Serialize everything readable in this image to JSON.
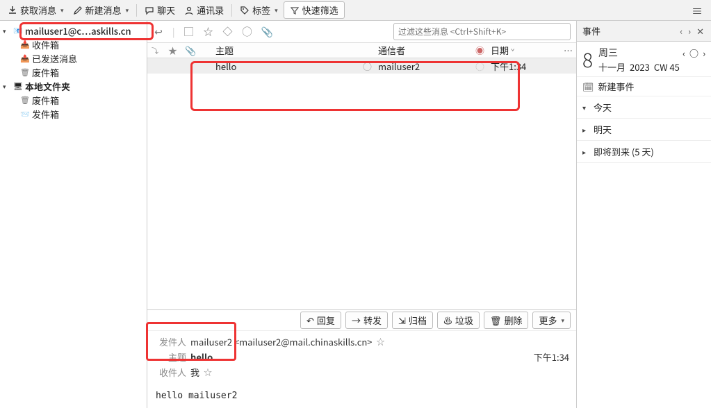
{
  "toolbar": {
    "get_msgs": "获取消息",
    "new_msg": "新建消息",
    "chat": "聊天",
    "contacts": "通讯录",
    "tags": "标签",
    "quick_filter": "快速筛选"
  },
  "sidebar": {
    "account": "mailuser1@c…askills.cn",
    "inbox": "收件箱",
    "sent": "已发送消息",
    "trash": "废件箱",
    "local": "本地文件夹",
    "local_trash": "废件箱",
    "outbox": "发件箱"
  },
  "filter_placeholder": "过滤这些消息 <Ctrl+Shift+K>",
  "columns": {
    "subject": "主题",
    "from": "通信者",
    "date": "日期"
  },
  "message": {
    "subject": "hello",
    "from": "mailuser2",
    "date": "下午1:34"
  },
  "actions": {
    "reply": "回复",
    "forward": "转发",
    "archive": "归档",
    "junk": "垃圾",
    "delete": "删除",
    "more": "更多"
  },
  "preview": {
    "from_label": "发件人",
    "from_value": "mailuser2 <mailuser2@mail.chinaskills.cn>",
    "subject_label": "主题",
    "subject_value": "hello",
    "to_label": "收件人",
    "to_value": "我",
    "time": "下午1:34",
    "body": "hello mailuser2"
  },
  "events": {
    "title": "事件",
    "day": "8",
    "weekday": "周三",
    "month": "十一月",
    "year": "2023",
    "cw": "CW 45",
    "new_event": "新建事件",
    "today": "今天",
    "tomorrow": "明天",
    "upcoming": "即将到来 (5 天)"
  }
}
